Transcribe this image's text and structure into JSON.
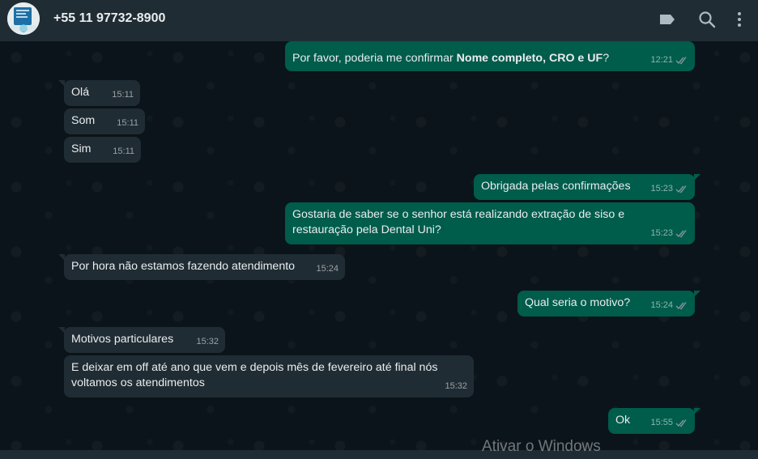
{
  "contact": {
    "name": "+55 11 97732-8900"
  },
  "colors": {
    "incoming": "#202c33",
    "outgoing": "#005c4b",
    "background": "#0b141a",
    "header": "#202c33"
  },
  "icons": {
    "labels": "label-tag-icon",
    "search": "search-icon",
    "menu": "more-vertical-icon",
    "read": "double-check-icon"
  },
  "messages": [
    {
      "direction": "out",
      "text_prefix": "Por favor, poderia me confirmar ",
      "text_bold": "Nome completo, CRO e UF",
      "text_suffix": "?",
      "time": "12:21"
    },
    {
      "direction": "in",
      "text": "Olá",
      "time": "15:11"
    },
    {
      "direction": "in",
      "text": "Som",
      "time": "15:11"
    },
    {
      "direction": "in",
      "text": "Sim",
      "time": "15:11"
    },
    {
      "direction": "out",
      "text": "Obrigada pelas confirmações",
      "time": "15:23"
    },
    {
      "direction": "out",
      "text": "Gostaria de saber se o senhor está realizando extração de siso e restauração pela Dental Uni?",
      "time": "15:23"
    },
    {
      "direction": "in",
      "text": "Por hora não estamos fazendo atendimento",
      "time": "15:24"
    },
    {
      "direction": "out",
      "text": "Qual seria o motivo?",
      "time": "15:24"
    },
    {
      "direction": "in",
      "text": "Motivos particulares",
      "time": "15:32"
    },
    {
      "direction": "in",
      "text": "E deixar em off até ano que vem e depois mês de fevereiro até final nós voltamos os atendimentos",
      "time": "15:32"
    },
    {
      "direction": "out",
      "text": "Ok",
      "time": "15:55"
    }
  ],
  "watermark": "Ativar o Windows"
}
